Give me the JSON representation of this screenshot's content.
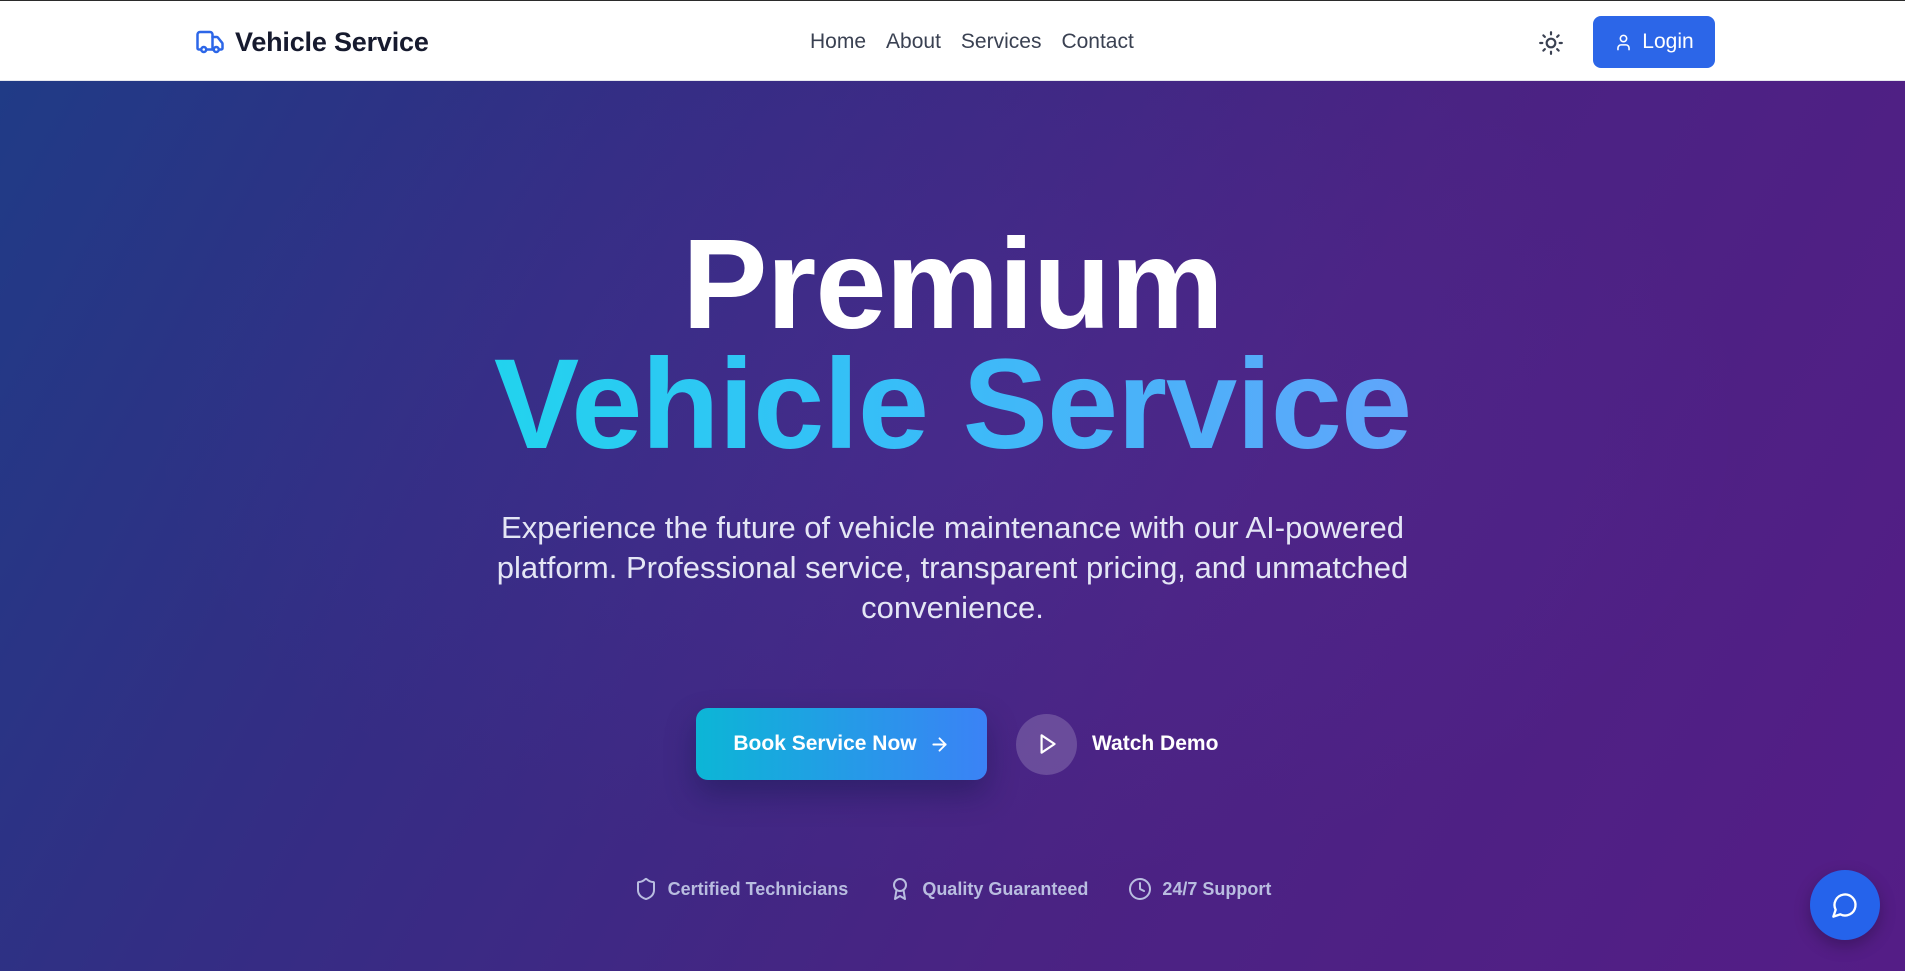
{
  "header": {
    "brand_name": "Vehicle Service",
    "brand_icon": "truck-icon",
    "nav": [
      {
        "label": "Home"
      },
      {
        "label": "About"
      },
      {
        "label": "Services"
      },
      {
        "label": "Contact"
      }
    ],
    "theme_icon": "sun-icon",
    "login_label": "Login",
    "login_icon": "user-icon"
  },
  "hero": {
    "title_line1": "Premium",
    "title_line2": "Vehicle Service",
    "subtitle": "Experience the future of vehicle maintenance with our AI-powered platform. Professional service, transparent pricing, and unmatched convenience.",
    "primary_cta": "Book Service Now",
    "primary_cta_icon": "arrow-right-icon",
    "secondary_cta": "Watch Demo",
    "secondary_cta_icon": "play-icon",
    "features": [
      {
        "label": "Certified Technicians",
        "icon": "shield-icon"
      },
      {
        "label": "Quality Guaranteed",
        "icon": "award-icon"
      },
      {
        "label": "24/7 Support",
        "icon": "clock-icon"
      }
    ]
  },
  "chat_icon": "chat-bubble-icon",
  "colors": {
    "accent": "#2c66e8",
    "hero_gradient_start": "#203b86",
    "hero_gradient_end": "#541d86",
    "title_gradient_start": "#22d3ee",
    "title_gradient_end": "#60a5fa",
    "cta_gradient_start": "#0cb6d6",
    "cta_gradient_end": "#3b82f6"
  }
}
